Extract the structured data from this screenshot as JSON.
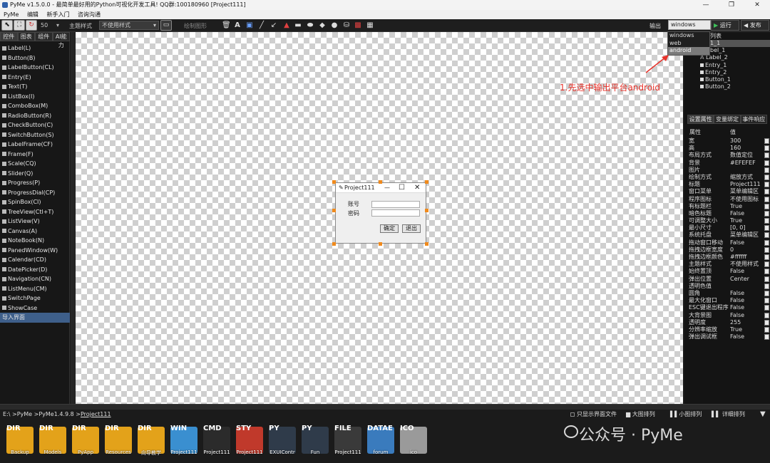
{
  "window": {
    "title": "PyMe v1.5.0.0 - 最简单最好用的Python可视化开发工具! QQ群:100180960   [Project111]",
    "minimize": "—",
    "maximize": "❐",
    "close": "✕"
  },
  "menu": [
    "PyMe",
    "编辑",
    "新手入门",
    "咨询沟通"
  ],
  "toolbar": {
    "font_size": "50",
    "theme_label": "主题样式",
    "theme_value": "不使用样式",
    "draw_label": "绘制图形",
    "output_label": "输出",
    "platform_value": "windows",
    "run_label": "运行",
    "publish_label": "发布"
  },
  "platform_options": [
    "windows",
    "web",
    "android"
  ],
  "platform_selected": "android",
  "left_tabs": [
    "控件",
    "图表",
    "组件",
    "AI能力"
  ],
  "components": [
    "Label(L)",
    "Button(B)",
    "LabelButton(CL)",
    "Entry(E)",
    "Text(T)",
    "ListBox(I)",
    "ComboBox(M)",
    "RadioButton(R)",
    "CheckButton(C)",
    "SwitchButton(S)",
    "LabelFrame(CF)",
    "Frame(F)",
    "Scale(CQ)",
    "Slider(Q)",
    "Progress(P)",
    "ProgressDial(CP)",
    "SpinBox(CI)",
    "TreeView(Ctl+T)",
    "ListView(V)",
    "Canvas(A)",
    "NoteBook(N)",
    "PanedWindow(W)",
    "Calendar(CD)",
    "DatePicker(D)",
    "Navigation(CN)",
    "ListMenu(CM)",
    "SwitchPage",
    "ShowCase",
    "导入界面"
  ],
  "components_selected": "导入界面",
  "form": {
    "title": "Project111",
    "min": "—",
    "max": "☐",
    "close": "✕",
    "label_account": "账号",
    "label_password": "密码",
    "ok_button": "确定",
    "exit_button": "退出"
  },
  "list_panel": {
    "header": "列表",
    "items": [
      "1_1",
      "bel_1",
      "Label_2",
      "Entry_1",
      "Entry_2",
      "Button_1",
      "Button_2"
    ]
  },
  "annotation": "1.先选中输出平台android",
  "prop_tabs": [
    "设置属性",
    "变量绑定",
    "事件响应"
  ],
  "prop_header": {
    "key": "属性",
    "value": "值"
  },
  "properties": [
    {
      "k": "宽",
      "v": "300"
    },
    {
      "k": "高",
      "v": "160"
    },
    {
      "k": "布局方式",
      "v": "数值定位"
    },
    {
      "k": "背景",
      "v": "#EFEFEF"
    },
    {
      "k": "图片",
      "v": ""
    },
    {
      "k": "绘制方式",
      "v": "缩放方式"
    },
    {
      "k": "标题",
      "v": "Project111"
    },
    {
      "k": "窗口菜单",
      "v": "菜单编辑区"
    },
    {
      "k": "程序图标",
      "v": "不使用图标"
    },
    {
      "k": "有标题栏",
      "v": "True"
    },
    {
      "k": "暗色标题",
      "v": "False"
    },
    {
      "k": "可调整大小",
      "v": "True"
    },
    {
      "k": "最小尺寸",
      "v": "[0, 0]"
    },
    {
      "k": "系统托盘",
      "v": "菜单编辑区"
    },
    {
      "k": "拖动窗口移动",
      "v": "False"
    },
    {
      "k": "拖拽边框宽度",
      "v": "0"
    },
    {
      "k": "拖拽边框颜色",
      "v": "#ffffff"
    },
    {
      "k": "主题样式",
      "v": "不使用样式"
    },
    {
      "k": "始终置顶",
      "v": "False"
    },
    {
      "k": "弹出位置",
      "v": "Center"
    },
    {
      "k": "透明色值",
      "v": ""
    },
    {
      "k": "圆角",
      "v": "False"
    },
    {
      "k": "最大化窗口",
      "v": "False"
    },
    {
      "k": "ESC键退出程序",
      "v": "False"
    },
    {
      "k": "大背景图",
      "v": "False"
    },
    {
      "k": "透明度",
      "v": "255"
    },
    {
      "k": "分辨率缩放",
      "v": "True"
    },
    {
      "k": "弹出调试框",
      "v": "False"
    }
  ],
  "bottom": {
    "path_prefix": "E:\\ >PyMe >PyMe1.4.9.8 >",
    "path_current": "Project111",
    "opt_only_ui": "只显示界面文件",
    "opt_large": "大图排列",
    "opt_small": "小图排列",
    "opt_detail": "详细排列",
    "collapse": "▼"
  },
  "files": [
    {
      "tag": "DIR",
      "name": "Backup",
      "color": "#e3a21a"
    },
    {
      "tag": "DIR",
      "name": "Models",
      "color": "#e3a21a"
    },
    {
      "tag": "DIR",
      "name": "PyApp",
      "color": "#e3a21a"
    },
    {
      "tag": "DIR",
      "name": "Resources",
      "color": "#e3a21a"
    },
    {
      "tag": "DIR",
      "name": "向导教学",
      "color": "#e3a21a"
    },
    {
      "tag": "WIN",
      "name": "Project111",
      "color": "#3a8fd0"
    },
    {
      "tag": "CMD",
      "name": "Project111",
      "color": "#2b2b2b"
    },
    {
      "tag": "STY",
      "name": "Project111",
      "color": "#c0392b"
    },
    {
      "tag": "PY",
      "name": "EXUIContr",
      "color": "#2f3b4a"
    },
    {
      "tag": "PY",
      "name": "Fun",
      "color": "#2f3b4a"
    },
    {
      "tag": "FILE",
      "name": "Project111",
      "color": "#3a3a3a"
    },
    {
      "tag": "DATAE",
      "name": "forum",
      "color": "#3a7bbd"
    },
    {
      "tag": "ICO",
      "name": "ico",
      "color": "#9a9a9a"
    }
  ],
  "watermark": "公众号 · PyMe"
}
